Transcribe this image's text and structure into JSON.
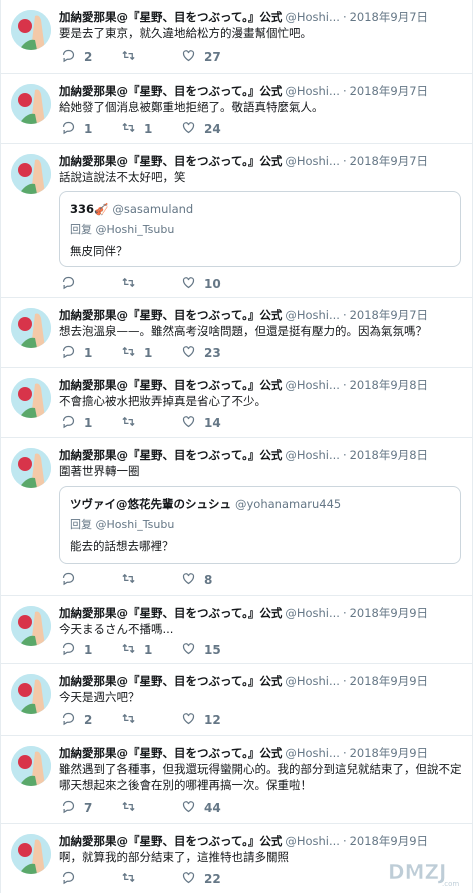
{
  "colors": {
    "text": "#14171a",
    "muted": "#657786",
    "border": "#e6ecf0"
  },
  "icons": {
    "reply": "reply-icon",
    "retweet": "retweet-icon",
    "like": "heart-icon"
  },
  "watermark": "DMZJ.com",
  "tweets": [
    {
      "name": "加納愛那果@『星野、目をつぶって。』公式",
      "handle": "@Hoshi...",
      "time": "2018年9月7日",
      "text": "要是去了東京，就久違地給松方的漫畫幫個忙吧。",
      "reply": "2",
      "retweet": "",
      "like": "27"
    },
    {
      "name": "加納愛那果@『星野、目をつぶって。』公式",
      "handle": "@Hoshi...",
      "time": "2018年9月7日",
      "text": "給她發了個消息被鄭重地拒絕了。敬語真特麼氣人。",
      "reply": "1",
      "retweet": "1",
      "like": "24"
    },
    {
      "name": "加納愛那果@『星野、目をつぶって。』公式",
      "handle": "@Hoshi...",
      "time": "2018年9月7日",
      "text": "話說這說法不太好吧，笑",
      "quote": {
        "name": "336🎻",
        "handle": "@sasamuland",
        "reply": "回复 @Hoshi_Tsubu",
        "text": "無皮同伴？"
      },
      "reply": "",
      "retweet": "",
      "like": "10"
    },
    {
      "name": "加納愛那果@『星野、目をつぶって。』公式",
      "handle": "@Hoshi...",
      "time": "2018年9月7日",
      "text": "想去泡溫泉——。雖然高考沒啥問題，但還是挺有壓力的。因為氣氛嗎？",
      "reply": "1",
      "retweet": "1",
      "like": "23"
    },
    {
      "name": "加納愛那果@『星野、目をつぶって。』公式",
      "handle": "@Hoshi...",
      "time": "2018年9月8日",
      "text": "不會擔心被水把妝弄掉真是省心了不少。",
      "reply": "1",
      "retweet": "",
      "like": "14"
    },
    {
      "name": "加納愛那果@『星野、目をつぶって。』公式",
      "handle": "@Hoshi...",
      "time": "2018年9月8日",
      "text": "圍著世界轉一圈",
      "quote": {
        "name": "ツヴァイ@悠花先輩のシュシュ",
        "handle": "@yohanamaru445",
        "reply": "回复 @Hoshi_Tsubu",
        "text": "能去的話想去哪裡？"
      },
      "reply": "",
      "retweet": "",
      "like": "8"
    },
    {
      "name": "加納愛那果@『星野、目をつぶって。』公式",
      "handle": "@Hoshi...",
      "time": "2018年9月9日",
      "text": "今天まるさん不播嗎...",
      "reply": "1",
      "retweet": "1",
      "like": "15"
    },
    {
      "name": "加納愛那果@『星野、目をつぶって。』公式",
      "handle": "@Hoshi...",
      "time": "2018年9月9日",
      "text": "今天是週六吧？",
      "reply": "2",
      "retweet": "",
      "like": "12"
    },
    {
      "name": "加納愛那果@『星野、目をつぶって。』公式",
      "handle": "@Hoshi...",
      "time": "2018年9月9日",
      "text": "雖然遇到了各種事，但我還玩得蠻開心的。我的部分到這兒就結束了，但說不定哪天想起來之後會在別的哪裡再搞一次。保重啦！",
      "reply": "7",
      "retweet": "",
      "like": "44"
    },
    {
      "name": "加納愛那果@『星野、目をつぶって。』公式",
      "handle": "@Hoshi...",
      "time": "2018年9月9日",
      "text": "啊，就算我的部分結束了，這推特也請多關照",
      "reply": "",
      "retweet": "",
      "like": "22"
    }
  ]
}
